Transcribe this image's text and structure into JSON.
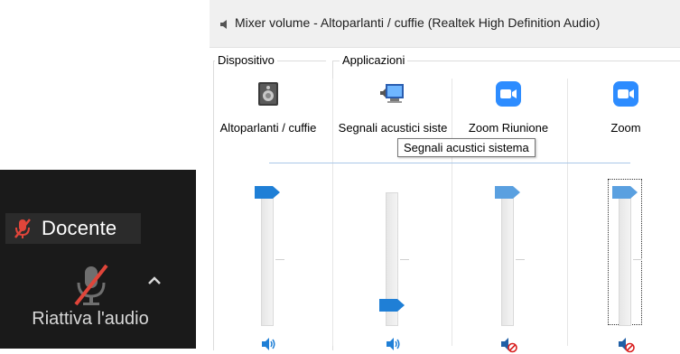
{
  "zoom": {
    "participant_name": "Docente",
    "unmute_label": "Riattiva l'audio",
    "colors": {
      "background": "#1a1a1a",
      "muted_red": "#e0453a"
    }
  },
  "mixer": {
    "title": "Mixer volume - Altoparlanti / cuffie (Realtek High Definition Audio)",
    "device_group_label": "Dispositivo",
    "apps_group_label": "Applicazioni",
    "channels": [
      {
        "name": "Altoparlanti / cuffie",
        "icon": "speaker-device-icon",
        "volume": 1.0,
        "muted": false
      },
      {
        "name": "Segnali acustici siste",
        "icon": "system-sounds-icon",
        "volume": 0.07,
        "muted": false
      },
      {
        "name": "Zoom Riunione",
        "icon": "zoom-camera-icon",
        "volume": 1.0,
        "muted": true
      },
      {
        "name": "Zoom",
        "icon": "zoom-camera-icon",
        "volume": 1.0,
        "muted": true
      }
    ],
    "tooltip": "Segnali acustici sistema",
    "colors": {
      "thumb": "#1f7fd6",
      "zoom_blue": "#2d8cff",
      "mute_red": "#d81e1e"
    }
  }
}
